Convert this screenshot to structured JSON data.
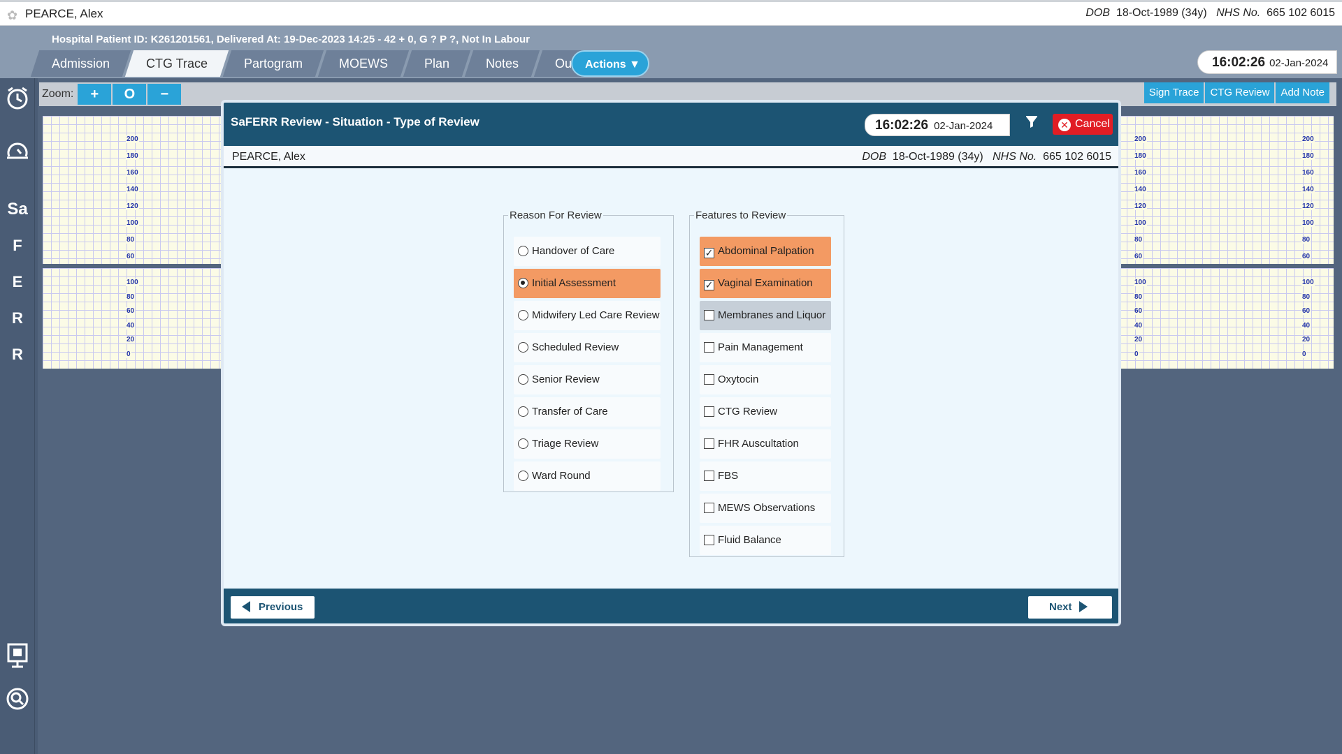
{
  "patient": {
    "name": "PEARCE, Alex",
    "dob_label": "DOB",
    "dob": "18-Oct-1989 (34y)",
    "nhs_label": "NHS No.",
    "nhs": "665 102 6015"
  },
  "subheader": {
    "info": "Hospital Patient ID: K261201561, Delivered At: 19-Dec-2023 14:25 - 42 + 0, G ? P ?,   Not In Labour"
  },
  "tabs": [
    "Admission",
    "CTG Trace",
    "Partogram",
    "MOEWS",
    "Plan",
    "Notes",
    "Outcome"
  ],
  "active_tab": "CTG Trace",
  "actions_label": "Actions",
  "clock": {
    "time": "16:02:26",
    "date": "02-Jan-2024"
  },
  "sidebar": [
    "Sa",
    "F",
    "E",
    "R",
    "R"
  ],
  "toolbar": {
    "zoom_label": "Zoom:",
    "zoom_in": "+",
    "zoom_reset": "O",
    "zoom_out": "−",
    "sign_trace": "Sign Trace",
    "ctg_review": "CTG Review",
    "add_note": "Add Note"
  },
  "ctg_ticks": {
    "upper": [
      "200",
      "180",
      "160",
      "140",
      "120",
      "100",
      "80",
      "60"
    ],
    "lower": [
      "100",
      "80",
      "60",
      "40",
      "20",
      "0"
    ]
  },
  "modal": {
    "title": "SaFERR Review - Situation - Type of Review",
    "time": "16:02:26",
    "date": "02-Jan-2024",
    "cancel": "Cancel",
    "reason_legend": "Reason For Review",
    "reasons": [
      "Handover of Care",
      "Initial Assessment",
      "Midwifery Led Care Review",
      "Scheduled Review",
      "Senior Review",
      "Transfer of Care",
      "Triage Review",
      "Ward Round"
    ],
    "selected_reason": "Initial Assessment",
    "features_legend": "Features to Review",
    "features": [
      "Abdominal Palpation",
      "Vaginal Examination",
      "Membranes and Liquor",
      "Pain Management",
      "Oxytocin",
      "CTG Review",
      "FHR Auscultation",
      "FBS",
      "MEWS Observations",
      "Fluid Balance"
    ],
    "checked_features": [
      "Abdominal Palpation",
      "Vaginal Examination"
    ],
    "previous": "Previous",
    "next": "Next"
  },
  "colors": {
    "header": "#1c5473",
    "selected": "#f39a63",
    "accent": "#2aa3d8",
    "cancel": "#e11d24"
  }
}
